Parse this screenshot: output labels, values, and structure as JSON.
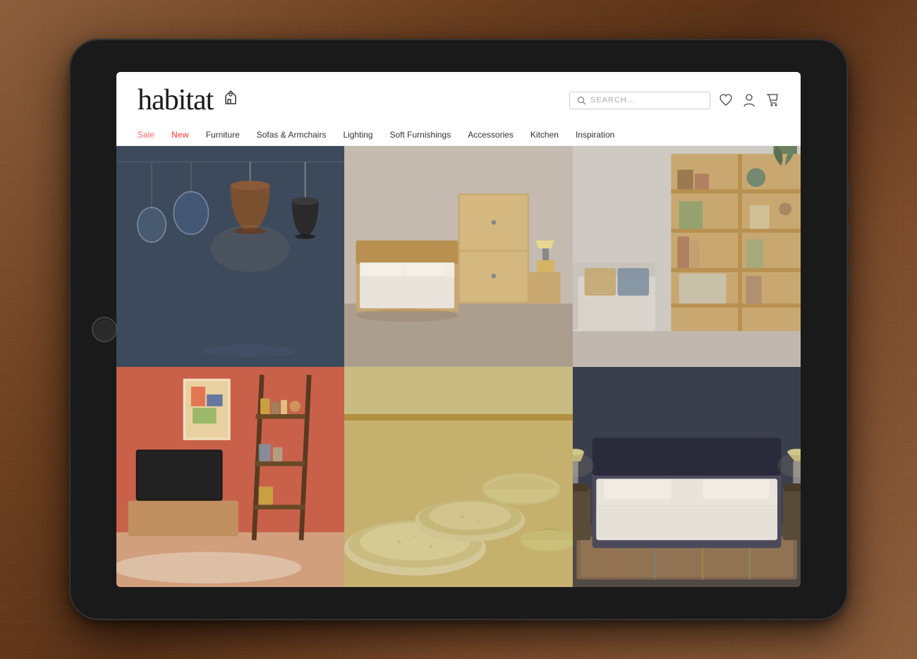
{
  "ipad": {
    "frame_color": "#1a1a1a"
  },
  "website": {
    "logo": {
      "text": "habitat",
      "icon": "⌂"
    },
    "search": {
      "placeholder": "SEARCH..."
    },
    "header_icons": {
      "wishlist": "♡",
      "account": "👤",
      "cart": "🛒"
    },
    "nav": {
      "items": [
        {
          "label": "Sale",
          "class": "sale"
        },
        {
          "label": "New",
          "class": "new-item"
        },
        {
          "label": "Furniture",
          "class": ""
        },
        {
          "label": "Sofas & Armchairs",
          "class": ""
        },
        {
          "label": "Lighting",
          "class": ""
        },
        {
          "label": "Soft Furnishings",
          "class": ""
        },
        {
          "label": "Accessories",
          "class": ""
        },
        {
          "label": "Kitchen",
          "class": ""
        },
        {
          "label": "Inspiration",
          "class": ""
        }
      ]
    },
    "products": [
      {
        "id": 1,
        "theme": "pendant-lights",
        "bg": "#3d4a5c"
      },
      {
        "id": 2,
        "theme": "bedroom",
        "bg": "#b8ad9e"
      },
      {
        "id": 3,
        "theme": "shelving",
        "bg": "#cec9c2"
      },
      {
        "id": 4,
        "theme": "living-room",
        "bg": "#c9614a"
      },
      {
        "id": 5,
        "theme": "ceramics",
        "bg": "#c8bc82"
      },
      {
        "id": 6,
        "theme": "dark-bedroom",
        "bg": "#3a3f4e"
      }
    ]
  }
}
